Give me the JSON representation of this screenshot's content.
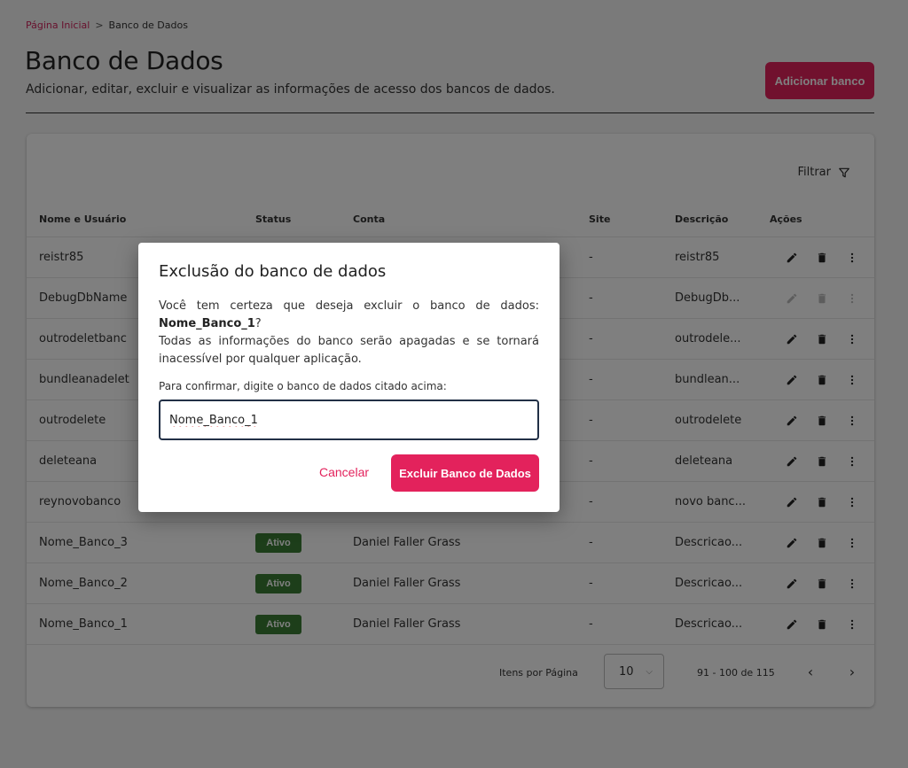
{
  "breadcrumb": {
    "home": "Página Inicial",
    "separator": ">",
    "current": "Banco de Dados"
  },
  "header": {
    "title": "Banco de Dados",
    "subtitle": "Adicionar, editar, excluir e visualizar as informações de acesso dos bancos de dados.",
    "add_button": "Adicionar banco"
  },
  "filter": {
    "label": "Filtrar",
    "icon": "filter-icon"
  },
  "table": {
    "columns": [
      "Nome e Usuário",
      "Status",
      "Conta",
      "Site",
      "Descrição",
      "Ações"
    ],
    "rows": [
      {
        "name": "reistr85",
        "status": "",
        "conta": "",
        "site": "-",
        "desc": "reistr85",
        "disabled": false
      },
      {
        "name": "DebugDbName",
        "status": "",
        "conta": "",
        "site": "-",
        "desc": "DebugDb...",
        "disabled": true
      },
      {
        "name": "outrodeletbanc",
        "status": "",
        "conta": "",
        "site": "-",
        "desc": "outrodele...",
        "disabled": false
      },
      {
        "name": "bundleanadelet",
        "status": "",
        "conta": "",
        "site": "-",
        "desc": "bundlean...",
        "disabled": false
      },
      {
        "name": "outrodelete",
        "status": "",
        "conta": "",
        "site": "-",
        "desc": "outrodelete",
        "disabled": false
      },
      {
        "name": "deleteana",
        "status": "",
        "conta": "",
        "site": "-",
        "desc": "deleteana",
        "disabled": false
      },
      {
        "name": "reynovobanco",
        "status": "",
        "conta": "",
        "site": "-",
        "desc": "novo banc...",
        "disabled": false
      },
      {
        "name": "Nome_Banco_3",
        "status": "Ativo",
        "conta": "Daniel Faller Grass",
        "site": "-",
        "desc": "Descricao...",
        "disabled": false
      },
      {
        "name": "Nome_Banco_2",
        "status": "Ativo",
        "conta": "Daniel Faller Grass",
        "site": "-",
        "desc": "Descricao...",
        "disabled": false
      },
      {
        "name": "Nome_Banco_1",
        "status": "Ativo",
        "conta": "Daniel Faller Grass",
        "site": "-",
        "desc": "Descricao...",
        "disabled": false
      }
    ],
    "action_icons": [
      "pencil-icon",
      "trash-icon",
      "more-vertical-icon"
    ]
  },
  "pagination": {
    "items_label": "Itens por Página",
    "per_page": "10",
    "range": "91 - 100 de 115",
    "prev": "‹",
    "next": "›"
  },
  "modal": {
    "title": "Exclusão do banco de dados",
    "text_before": "Você tem certeza que deseja excluir o banco de dados: ",
    "db_name": "Nome_Banco_1",
    "text_q": "?",
    "text_after": "Todas as informações do banco serão apagadas e se tornará inacessível por qualquer aplicação.",
    "confirm_label": "Para confirmar, digite o banco de dados citado acima:",
    "input_value": "Nome_Banco_1",
    "cancel": "Cancelar",
    "delete": "Excluir Banco de Dados"
  },
  "colors": {
    "accent": "#e3225c",
    "status_active": "#3a7d34",
    "overlay": "#000000"
  }
}
